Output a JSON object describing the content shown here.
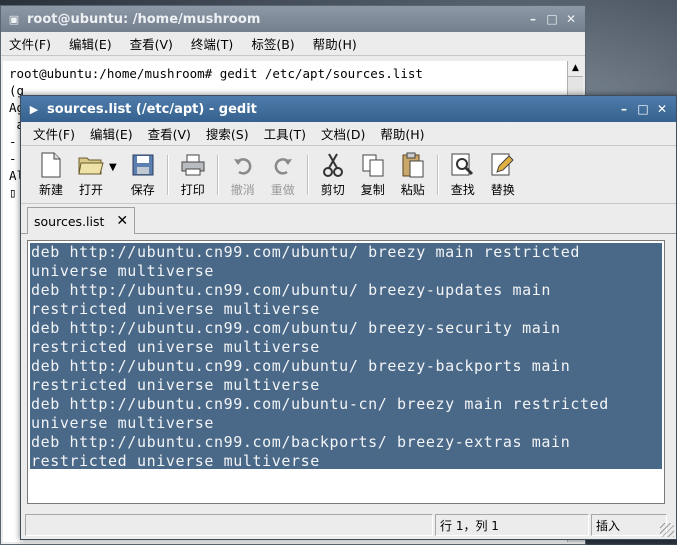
{
  "terminal": {
    "title": "root@ubuntu: /home/mushroom",
    "menu": [
      "文件(F)",
      "编辑(E)",
      "查看(V)",
      "终端(T)",
      "标签(B)",
      "帮助(H)"
    ],
    "lines": [
      "root@ubuntu:/home/mushroom# gedit /etc/apt/sources.list",
      "",
      "(g",
      "Ag",
      " a",
      "-",
      "-",
      "Al",
      "▯"
    ]
  },
  "gedit": {
    "title": "sources.list (/etc/apt) - gedit",
    "menu": [
      "文件(F)",
      "编辑(E)",
      "查看(V)",
      "搜索(S)",
      "工具(T)",
      "文档(D)",
      "帮助(H)"
    ],
    "toolbar": {
      "new": "新建",
      "open": "打开",
      "save": "保存",
      "print": "打印",
      "undo": "撤消",
      "redo": "重做",
      "cut": "剪切",
      "copy": "复制",
      "paste": "粘贴",
      "find": "查找",
      "replace": "替换"
    },
    "tab": {
      "label": "sources.list",
      "close": "✕"
    },
    "lines": [
      "deb http://ubuntu.cn99.com/ubuntu/ breezy main restricted",
      "universe multiverse",
      "deb http://ubuntu.cn99.com/ubuntu/ breezy-updates main",
      "restricted universe multiverse",
      "deb http://ubuntu.cn99.com/ubuntu/ breezy-security main",
      "restricted universe multiverse",
      "deb http://ubuntu.cn99.com/ubuntu/ breezy-backports main",
      "restricted universe multiverse",
      "deb http://ubuntu.cn99.com/ubuntu-cn/ breezy main restricted",
      "universe multiverse",
      "deb http://ubuntu.cn99.com/backports/ breezy-extras main",
      "restricted universe multiverse"
    ],
    "status": {
      "message": "",
      "position": "行 1，列 1",
      "mode": "插入"
    }
  }
}
